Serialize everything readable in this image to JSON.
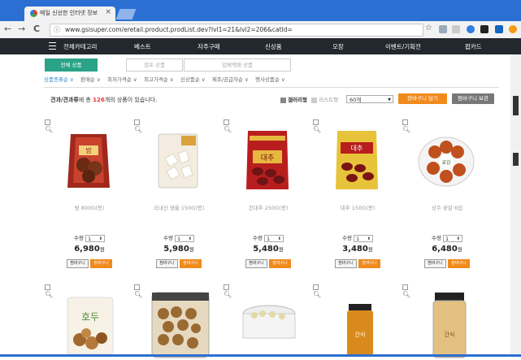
{
  "browser": {
    "tab_title": "매일 신선한 인터넷 장보",
    "tab_close": "×",
    "url": "www.gsisuper.com/eretail.product.prodList.dev?lvl1=21&lvl2=206&catId=",
    "back": "←",
    "forward": "→",
    "reload": "C",
    "info": "ⓘ",
    "star": "☆"
  },
  "nav": {
    "items": [
      "전체카테고리",
      "베스트",
      "자주구매",
      "신상품",
      "오장",
      "이벤트/기획전",
      "팝카드"
    ]
  },
  "tabs": [
    "전체 상품",
    "점포 상품",
    "업체택배 상품"
  ],
  "sort": [
    "상품종류순 ∨",
    "판매순 ∨",
    "최저가격순 ∨",
    "최고가격순 ∨",
    "신상품순 ∨",
    "제조/공급자순 ∨",
    "행사상품순 ∨"
  ],
  "results": {
    "category": "견과/견과류",
    "prefix": "에 총",
    "count": "126",
    "suffix": "개의 상품이 있습니다.",
    "view_gallery": "갤러리형",
    "view_list": "리스트형",
    "per_page": "60개",
    "cart_button": "장바구니 담기",
    "keep_button": "찜바구니 보관"
  },
  "products": [
    {
      "name": "밤 800G(봉)",
      "qty_label": "수량",
      "qty": "1",
      "price": "6,980",
      "won": "원",
      "keep": "찜바구니",
      "cart": "장바구니"
    },
    {
      "name": "국내산 생율 150G(봉)",
      "qty_label": "수량",
      "qty": "1",
      "price": "5,980",
      "won": "원",
      "keep": "찜바구니",
      "cart": "장바구니"
    },
    {
      "name": "건대추 250G(봉)",
      "qty_label": "수량",
      "qty": "1",
      "price": "5,480",
      "won": "원",
      "keep": "찜바구니",
      "cart": "장바구니"
    },
    {
      "name": "대추 150G(봉)",
      "qty_label": "수량",
      "qty": "1",
      "price": "3,480",
      "won": "원",
      "keep": "찜바구니",
      "cart": "장바구니"
    },
    {
      "name": "상주 곶감 6입",
      "qty_label": "수량",
      "qty": "1",
      "price": "6,480",
      "won": "원",
      "keep": "찜바구니",
      "cart": "장바구니"
    }
  ],
  "colors": {
    "accent_green": "#2aa387",
    "orange": "#f08a1c",
    "nav_bg": "#23282f",
    "chrome_blue": "#2b6fd2"
  },
  "icons": {
    "pkg1_label": "밤",
    "pkg3_label": "대추",
    "pkg4_label": "대추",
    "pkg5_label": "곶감",
    "row2_label1": "호두",
    "row2_label2": "간식"
  }
}
